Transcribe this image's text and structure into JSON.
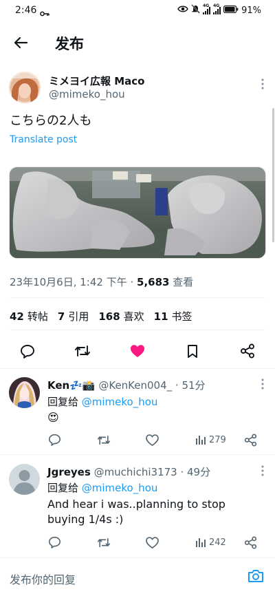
{
  "status_bar": {
    "time": "2:46",
    "network_1": "4G",
    "network_2": "4G",
    "battery": "91%"
  },
  "header": {
    "title": "发布"
  },
  "post": {
    "display_name": "ミメヨイ広報 Maco",
    "handle": "@mimeko_hou",
    "text": "こちらの2人も",
    "translate": "Translate post",
    "timestamp": "23年10月6日, 1:42 下午 · ",
    "views_count": "5,683",
    "views_label": " 查看",
    "stats": [
      {
        "count": "42",
        "label": "转帖"
      },
      {
        "count": "7",
        "label": "引用"
      },
      {
        "count": "168",
        "label": "喜欢"
      },
      {
        "count": "11",
        "label": "书签"
      }
    ],
    "colors": {
      "liked": "#f91880",
      "link": "#1d9bf0"
    }
  },
  "replies": [
    {
      "name": "Ken💤📸",
      "handle": "@KenKen004_",
      "time": " · 51分",
      "reply_prefix": "回复给 ",
      "reply_to": "@mimeko_hou",
      "text": "😍",
      "views": "279"
    },
    {
      "name": "Jgreyes",
      "handle": "@muchichi3173",
      "time": " · 49分",
      "reply_prefix": "回复给 ",
      "reply_to": "@mimeko_hou",
      "text": "And hear i was..planning to stop buying 1/4s :)",
      "views": "242"
    }
  ],
  "composer": {
    "placeholder": "发布你的回复"
  }
}
